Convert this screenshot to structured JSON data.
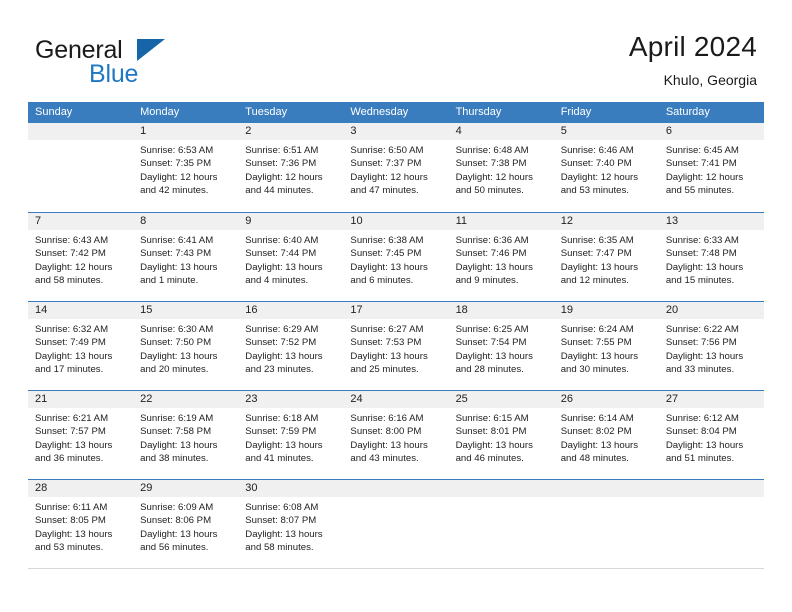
{
  "brand": {
    "word1": "General",
    "word2": "Blue",
    "flag_color": "#1565a8",
    "blue_text_color": "#1f78c1"
  },
  "header": {
    "title": "April 2024",
    "subtitle": "Khulo, Georgia"
  },
  "calendar": {
    "header_bg": "#3a7dbf",
    "day_band_bg": "#f0f0f0",
    "weekdays": [
      "Sunday",
      "Monday",
      "Tuesday",
      "Wednesday",
      "Thursday",
      "Friday",
      "Saturday"
    ],
    "weeks": [
      [
        {
          "day": "",
          "lines": []
        },
        {
          "day": "1",
          "lines": [
            "Sunrise: 6:53 AM",
            "Sunset: 7:35 PM",
            "Daylight: 12 hours",
            "and 42 minutes."
          ]
        },
        {
          "day": "2",
          "lines": [
            "Sunrise: 6:51 AM",
            "Sunset: 7:36 PM",
            "Daylight: 12 hours",
            "and 44 minutes."
          ]
        },
        {
          "day": "3",
          "lines": [
            "Sunrise: 6:50 AM",
            "Sunset: 7:37 PM",
            "Daylight: 12 hours",
            "and 47 minutes."
          ]
        },
        {
          "day": "4",
          "lines": [
            "Sunrise: 6:48 AM",
            "Sunset: 7:38 PM",
            "Daylight: 12 hours",
            "and 50 minutes."
          ]
        },
        {
          "day": "5",
          "lines": [
            "Sunrise: 6:46 AM",
            "Sunset: 7:40 PM",
            "Daylight: 12 hours",
            "and 53 minutes."
          ]
        },
        {
          "day": "6",
          "lines": [
            "Sunrise: 6:45 AM",
            "Sunset: 7:41 PM",
            "Daylight: 12 hours",
            "and 55 minutes."
          ]
        }
      ],
      [
        {
          "day": "7",
          "lines": [
            "Sunrise: 6:43 AM",
            "Sunset: 7:42 PM",
            "Daylight: 12 hours",
            "and 58 minutes."
          ]
        },
        {
          "day": "8",
          "lines": [
            "Sunrise: 6:41 AM",
            "Sunset: 7:43 PM",
            "Daylight: 13 hours",
            "and 1 minute."
          ]
        },
        {
          "day": "9",
          "lines": [
            "Sunrise: 6:40 AM",
            "Sunset: 7:44 PM",
            "Daylight: 13 hours",
            "and 4 minutes."
          ]
        },
        {
          "day": "10",
          "lines": [
            "Sunrise: 6:38 AM",
            "Sunset: 7:45 PM",
            "Daylight: 13 hours",
            "and 6 minutes."
          ]
        },
        {
          "day": "11",
          "lines": [
            "Sunrise: 6:36 AM",
            "Sunset: 7:46 PM",
            "Daylight: 13 hours",
            "and 9 minutes."
          ]
        },
        {
          "day": "12",
          "lines": [
            "Sunrise: 6:35 AM",
            "Sunset: 7:47 PM",
            "Daylight: 13 hours",
            "and 12 minutes."
          ]
        },
        {
          "day": "13",
          "lines": [
            "Sunrise: 6:33 AM",
            "Sunset: 7:48 PM",
            "Daylight: 13 hours",
            "and 15 minutes."
          ]
        }
      ],
      [
        {
          "day": "14",
          "lines": [
            "Sunrise: 6:32 AM",
            "Sunset: 7:49 PM",
            "Daylight: 13 hours",
            "and 17 minutes."
          ]
        },
        {
          "day": "15",
          "lines": [
            "Sunrise: 6:30 AM",
            "Sunset: 7:50 PM",
            "Daylight: 13 hours",
            "and 20 minutes."
          ]
        },
        {
          "day": "16",
          "lines": [
            "Sunrise: 6:29 AM",
            "Sunset: 7:52 PM",
            "Daylight: 13 hours",
            "and 23 minutes."
          ]
        },
        {
          "day": "17",
          "lines": [
            "Sunrise: 6:27 AM",
            "Sunset: 7:53 PM",
            "Daylight: 13 hours",
            "and 25 minutes."
          ]
        },
        {
          "day": "18",
          "lines": [
            "Sunrise: 6:25 AM",
            "Sunset: 7:54 PM",
            "Daylight: 13 hours",
            "and 28 minutes."
          ]
        },
        {
          "day": "19",
          "lines": [
            "Sunrise: 6:24 AM",
            "Sunset: 7:55 PM",
            "Daylight: 13 hours",
            "and 30 minutes."
          ]
        },
        {
          "day": "20",
          "lines": [
            "Sunrise: 6:22 AM",
            "Sunset: 7:56 PM",
            "Daylight: 13 hours",
            "and 33 minutes."
          ]
        }
      ],
      [
        {
          "day": "21",
          "lines": [
            "Sunrise: 6:21 AM",
            "Sunset: 7:57 PM",
            "Daylight: 13 hours",
            "and 36 minutes."
          ]
        },
        {
          "day": "22",
          "lines": [
            "Sunrise: 6:19 AM",
            "Sunset: 7:58 PM",
            "Daylight: 13 hours",
            "and 38 minutes."
          ]
        },
        {
          "day": "23",
          "lines": [
            "Sunrise: 6:18 AM",
            "Sunset: 7:59 PM",
            "Daylight: 13 hours",
            "and 41 minutes."
          ]
        },
        {
          "day": "24",
          "lines": [
            "Sunrise: 6:16 AM",
            "Sunset: 8:00 PM",
            "Daylight: 13 hours",
            "and 43 minutes."
          ]
        },
        {
          "day": "25",
          "lines": [
            "Sunrise: 6:15 AM",
            "Sunset: 8:01 PM",
            "Daylight: 13 hours",
            "and 46 minutes."
          ]
        },
        {
          "day": "26",
          "lines": [
            "Sunrise: 6:14 AM",
            "Sunset: 8:02 PM",
            "Daylight: 13 hours",
            "and 48 minutes."
          ]
        },
        {
          "day": "27",
          "lines": [
            "Sunrise: 6:12 AM",
            "Sunset: 8:04 PM",
            "Daylight: 13 hours",
            "and 51 minutes."
          ]
        }
      ],
      [
        {
          "day": "28",
          "lines": [
            "Sunrise: 6:11 AM",
            "Sunset: 8:05 PM",
            "Daylight: 13 hours",
            "and 53 minutes."
          ]
        },
        {
          "day": "29",
          "lines": [
            "Sunrise: 6:09 AM",
            "Sunset: 8:06 PM",
            "Daylight: 13 hours",
            "and 56 minutes."
          ]
        },
        {
          "day": "30",
          "lines": [
            "Sunrise: 6:08 AM",
            "Sunset: 8:07 PM",
            "Daylight: 13 hours",
            "and 58 minutes."
          ]
        },
        {
          "day": "",
          "lines": []
        },
        {
          "day": "",
          "lines": []
        },
        {
          "day": "",
          "lines": []
        },
        {
          "day": "",
          "lines": []
        }
      ]
    ]
  }
}
